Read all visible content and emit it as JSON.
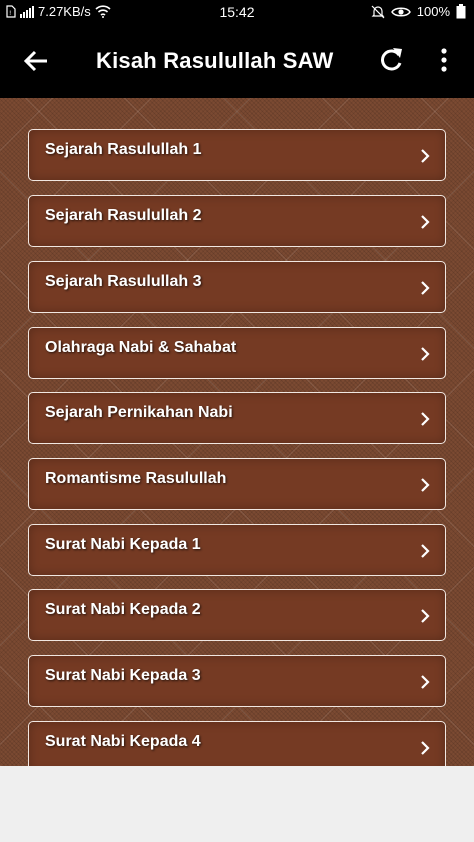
{
  "status_bar": {
    "network_speed": "7.27KB/s",
    "time": "15:42",
    "battery": "100%"
  },
  "app_bar": {
    "title": "Kisah Rasulullah SAW",
    "back_icon": "back-arrow-icon",
    "refresh_icon": "refresh-icon",
    "more_icon": "more-vert-icon"
  },
  "colors": {
    "app_bar": "#000000",
    "background": "#7b4a32",
    "item_fill": "#753a23",
    "item_border": "#f1e7e1"
  },
  "menu": {
    "items": [
      {
        "label": "Sejarah Rasulullah 1"
      },
      {
        "label": "Sejarah Rasulullah 2"
      },
      {
        "label": "Sejarah Rasulullah 3"
      },
      {
        "label": "Olahraga Nabi & Sahabat"
      },
      {
        "label": "Sejarah Pernikahan Nabi"
      },
      {
        "label": "Romantisme Rasulullah"
      },
      {
        "label": "Surat Nabi Kepada 1"
      },
      {
        "label": "Surat Nabi Kepada 2"
      },
      {
        "label": "Surat Nabi Kepada 3"
      },
      {
        "label": "Surat Nabi Kepada 4"
      }
    ]
  }
}
